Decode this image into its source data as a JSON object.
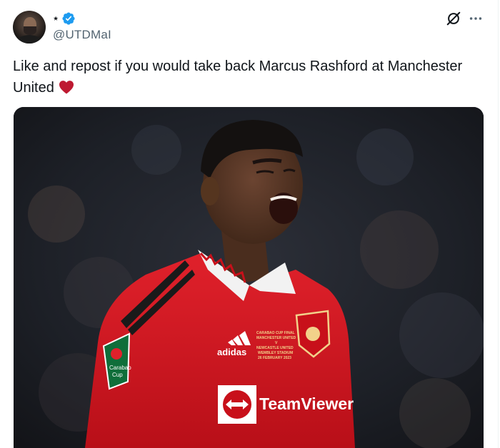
{
  "tweet": {
    "author": {
      "display_name": "⋆",
      "handle": "@UTDMaI",
      "verified": true,
      "avatar_icon": "avatar-photo"
    },
    "text": "Like and repost if you would take back Marcus Rashford at Manchester United",
    "emoji_icon": "red-heart-icon",
    "header_icons": [
      "grok-icon",
      "more-options-icon"
    ],
    "media": {
      "shirt_print": {
        "sponsor_text": "TeamViewer",
        "kit_brand": "adidas",
        "cup_badge_lines": [
          "Carabao",
          "Cup"
        ],
        "final_text": [
          "CARABAO CUP FINAL",
          "MANCHESTER UNITED",
          "V",
          "NEWCASTLE UNITED",
          "WEMBLEY STADIUM",
          "26 FEBRUARY 2023"
        ]
      }
    },
    "colors": {
      "verified_blue": "#1d9bf0",
      "heart_red": "#be1931",
      "shirt_red": "#d4141f",
      "handle_gray": "#536471"
    }
  }
}
